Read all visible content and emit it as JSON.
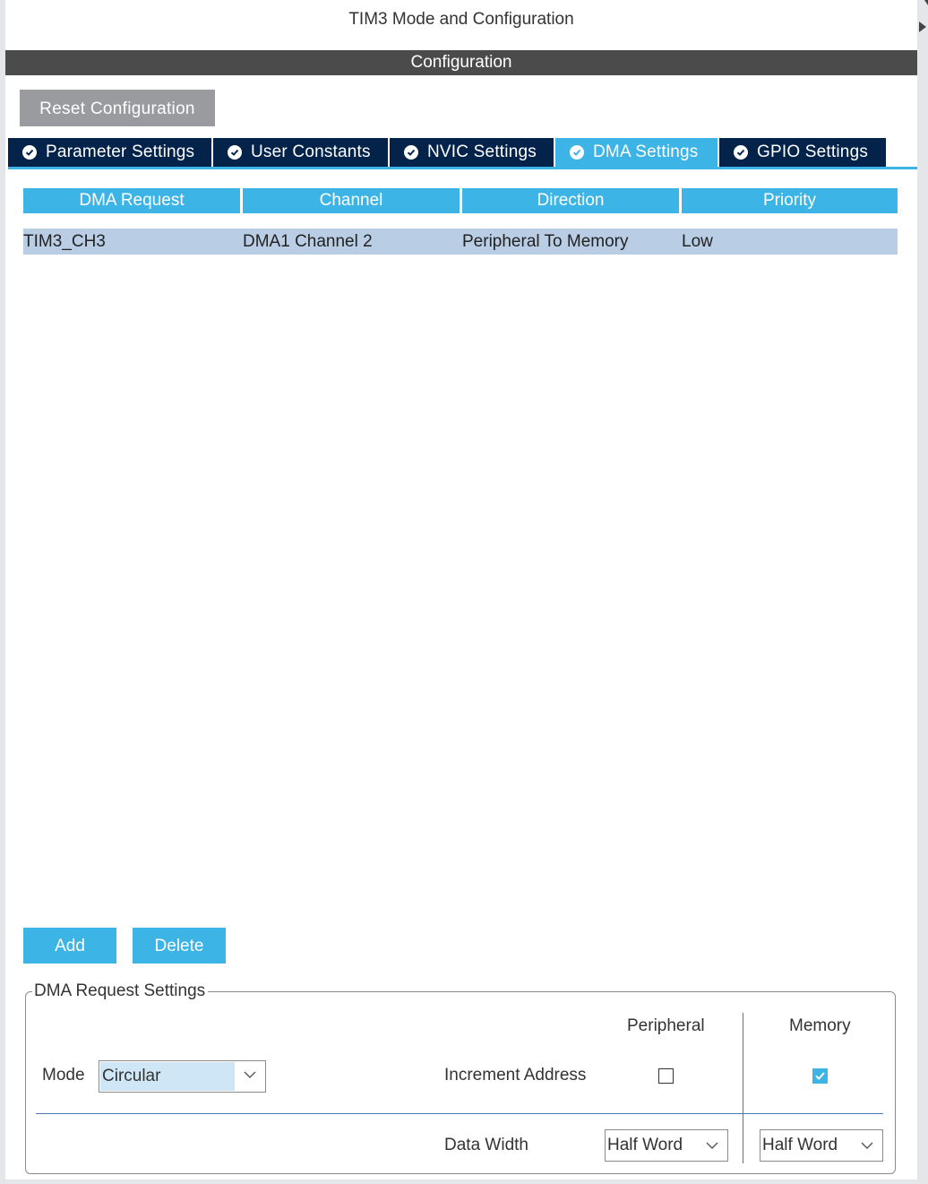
{
  "window": {
    "title": "TIM3 Mode and Configuration",
    "section_title": "Configuration"
  },
  "toolbar": {
    "reset_label": "Reset Configuration"
  },
  "tabs": [
    {
      "label": "Parameter Settings",
      "active": false
    },
    {
      "label": "User Constants",
      "active": false
    },
    {
      "label": "NVIC Settings",
      "active": false
    },
    {
      "label": "DMA Settings",
      "active": true
    },
    {
      "label": "GPIO Settings",
      "active": false
    }
  ],
  "dma_table": {
    "columns": [
      "DMA Request",
      "Channel",
      "Direction",
      "Priority"
    ],
    "rows": [
      [
        "TIM3_CH3",
        "DMA1 Channel 2",
        "Peripheral To Memory",
        "Low"
      ]
    ]
  },
  "actions": {
    "add_label": "Add",
    "delete_label": "Delete"
  },
  "request_settings": {
    "legend": "DMA Request Settings",
    "mode_label": "Mode",
    "mode_value": "Circular",
    "peripheral_header": "Peripheral",
    "memory_header": "Memory",
    "increment_label": "Increment Address",
    "increment_peripheral": false,
    "increment_memory": true,
    "data_width_label": "Data Width",
    "data_width_peripheral": "Half Word",
    "data_width_memory": "Half Word"
  },
  "colors": {
    "accent": "#3cb4e6",
    "tab_dark": "#03234b",
    "header_dark": "#4b4b4b",
    "row_selected": "#b9cde5"
  }
}
